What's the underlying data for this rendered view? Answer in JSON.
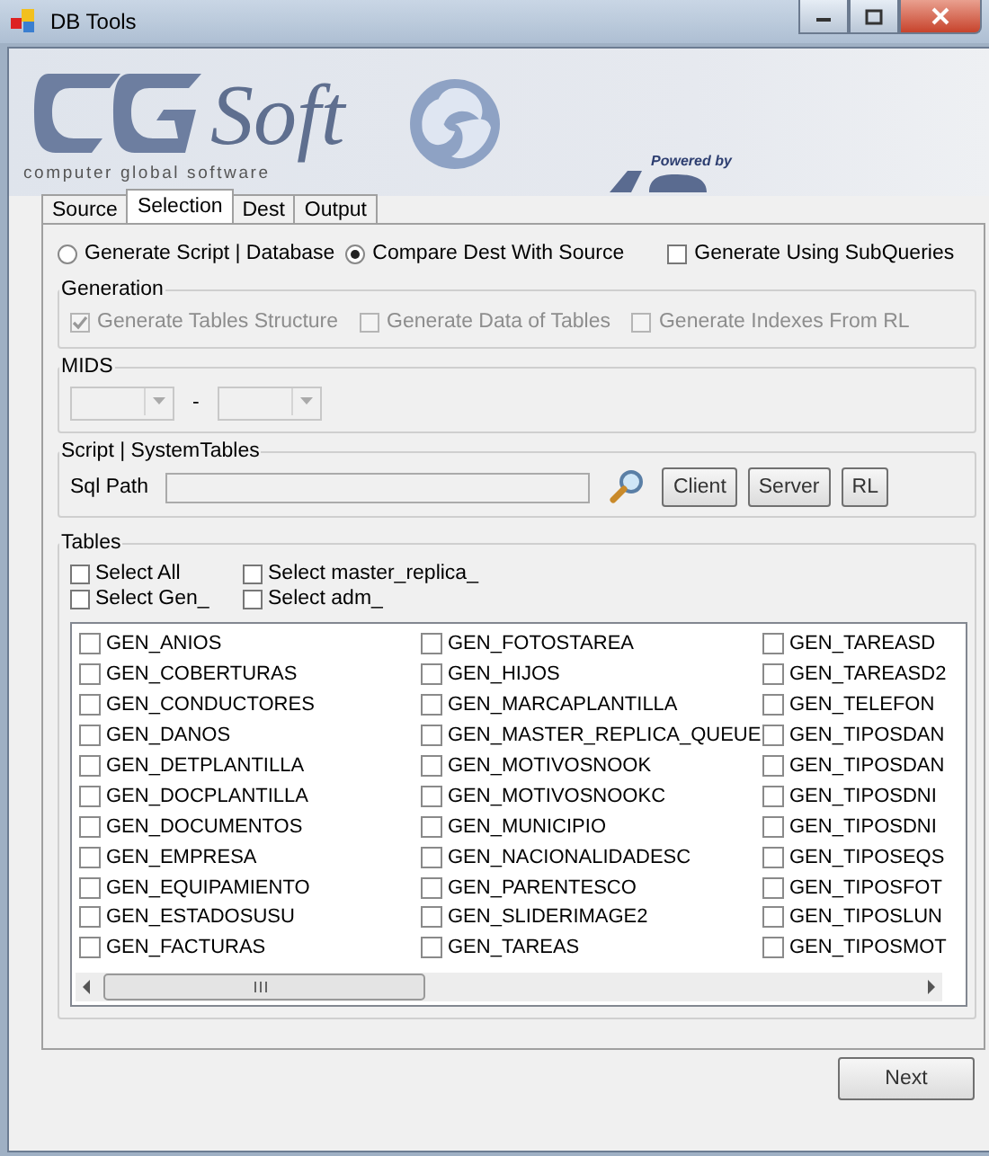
{
  "window": {
    "title": "DB Tools"
  },
  "logo": {
    "name": "Soft",
    "tagline": "computer global software",
    "powered": "Powered by"
  },
  "tabs": [
    {
      "label": "Source",
      "selected": false
    },
    {
      "label": "Selection",
      "selected": true
    },
    {
      "label": "Dest",
      "selected": false
    },
    {
      "label": "Output",
      "selected": false
    }
  ],
  "mode_options": [
    {
      "label": "Generate Script | Database",
      "selected": false
    },
    {
      "label": "Compare Dest With Source",
      "selected": true
    }
  ],
  "subqueries": {
    "label": "Generate Using SubQueries",
    "checked": false
  },
  "generation": {
    "title": "Generation",
    "options": [
      {
        "label": "Generate Tables Structure",
        "checked": true,
        "disabled": true
      },
      {
        "label": "Generate Data of Tables",
        "checked": false,
        "disabled": true
      },
      {
        "label": "Generate Indexes From RL",
        "checked": false,
        "disabled": true
      }
    ]
  },
  "mids": {
    "title": "MIDS",
    "separator": "-"
  },
  "script": {
    "title": "Script | SystemTables",
    "label": "Sql Path",
    "buttons": [
      "Client",
      "Server",
      "RL"
    ]
  },
  "tables": {
    "title": "Tables",
    "selectors": [
      {
        "label": "Select All",
        "checked": false
      },
      {
        "label": "Select Gen_",
        "checked": false
      },
      {
        "label": "Select master_replica_",
        "checked": false
      },
      {
        "label": "Select adm_",
        "checked": false
      }
    ],
    "columns": [
      {
        "items": [
          {
            "label": "GEN_ANIOS",
            "checked": false
          },
          {
            "label": "GEN_COBERTURAS",
            "checked": false
          },
          {
            "label": "GEN_CONDUCTORES",
            "checked": false
          },
          {
            "label": "GEN_DANOS",
            "checked": false
          },
          {
            "label": "GEN_DETPLANTILLA",
            "checked": false
          },
          {
            "label": "GEN_DOCPLANTILLA",
            "checked": false
          },
          {
            "label": "GEN_DOCUMENTOS",
            "checked": false
          },
          {
            "label": "GEN_EMPRESA",
            "checked": false
          },
          {
            "label": "GEN_EQUIPAMIENTO",
            "checked": false
          },
          {
            "label": "GEN_ESTADOSUSU",
            "checked": false
          },
          {
            "label": "GEN_FACTURAS",
            "checked": false
          }
        ]
      },
      {
        "items": [
          {
            "label": "GEN_FOTOSTAREA",
            "checked": false
          },
          {
            "label": "GEN_HIJOS",
            "checked": false
          },
          {
            "label": "GEN_MARCAPLANTILLA",
            "checked": false
          },
          {
            "label": "GEN_MASTER_REPLICA_QUEUE",
            "checked": false
          },
          {
            "label": "GEN_MOTIVOSNOOK",
            "checked": false
          },
          {
            "label": "GEN_MOTIVOSNOOKC",
            "checked": false
          },
          {
            "label": "GEN_MUNICIPIO",
            "checked": false
          },
          {
            "label": "GEN_NACIONALIDADESC",
            "checked": false
          },
          {
            "label": "GEN_PARENTESCO",
            "checked": false
          },
          {
            "label": "GEN_SLIDERIMAGE2",
            "checked": false
          },
          {
            "label": "GEN_TAREAS",
            "checked": false
          }
        ]
      },
      {
        "items": [
          {
            "label": "GEN_TAREASD",
            "checked": false
          },
          {
            "label": "GEN_TAREASD2",
            "checked": false
          },
          {
            "label": "GEN_TELEFON",
            "checked": false
          },
          {
            "label": "GEN_TIPOSDAN",
            "checked": false
          },
          {
            "label": "GEN_TIPOSDAN",
            "checked": false
          },
          {
            "label": "GEN_TIPOSDNI",
            "checked": false
          },
          {
            "label": "GEN_TIPOSDNI",
            "checked": false
          },
          {
            "label": "GEN_TIPOSEQS",
            "checked": false
          },
          {
            "label": "GEN_TIPOSFOT",
            "checked": false
          },
          {
            "label": "GEN_TIPOSLUN",
            "checked": false
          },
          {
            "label": "GEN_TIPOSMOT",
            "checked": false
          }
        ]
      }
    ]
  },
  "next_button": "Next"
}
